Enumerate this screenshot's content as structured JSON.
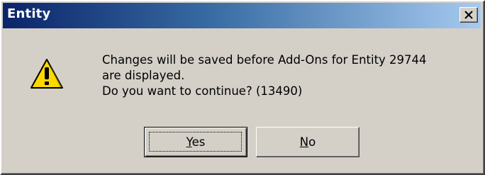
{
  "window": {
    "title": "Entity",
    "close_icon": "close-icon"
  },
  "message": {
    "icon": "warning-icon",
    "lines": [
      "Changes will be saved before Add-Ons for Entity 29744",
      "are displayed.",
      "Do you want to continue?  (13490)"
    ]
  },
  "buttons": {
    "yes": {
      "mnemonic": "Y",
      "rest": "es"
    },
    "no": {
      "mnemonic": "N",
      "rest": "o"
    }
  },
  "colors": {
    "titlebar_start": "#0a246a",
    "titlebar_end": "#a6caf0",
    "dialog_face": "#d4d0c8",
    "warning_yellow": "#ffd800"
  }
}
